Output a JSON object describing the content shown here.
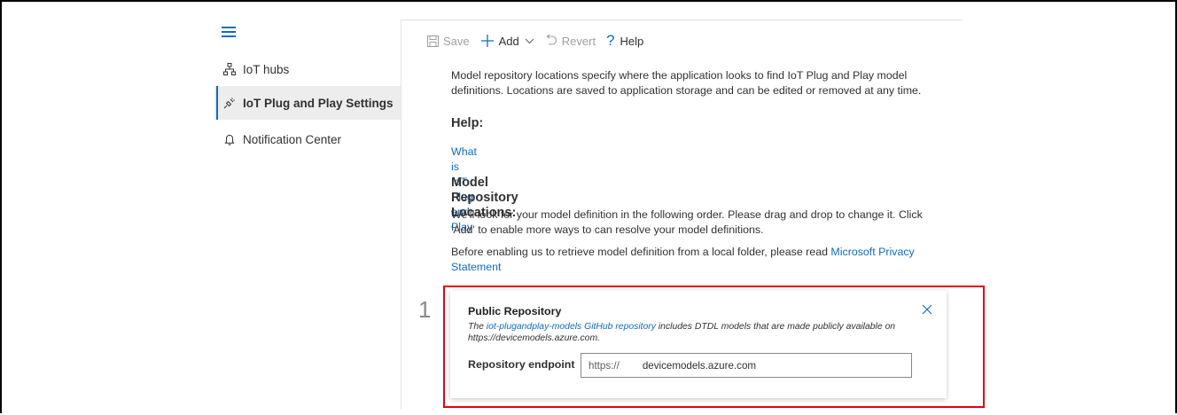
{
  "sidebar": {
    "items": [
      {
        "label": "IoT hubs",
        "icon": "hub-icon"
      },
      {
        "label": "IoT Plug and Play Settings",
        "icon": "plug-icon",
        "active": true
      },
      {
        "label": "Notification Center",
        "icon": "bell-icon"
      }
    ]
  },
  "toolbar": {
    "save_label": "Save",
    "add_label": "Add",
    "revert_label": "Revert",
    "help_label": "Help"
  },
  "main": {
    "intro": "Model repository locations specify where the application looks to find IoT Plug and Play model definitions. Locations are saved to application storage and can be edited or removed at any time.",
    "help_heading": "Help:",
    "help_link": "What is IoT Plug and Play",
    "locations_heading": "Model Repository Locations:",
    "order_text": "We'll look for your model definition in the following order. Please drag and drop to change it. Click 'Add' to enable more ways to can resolve your model definitions.",
    "privacy_prefix": "Before enabling us to retrieve model definition from a local folder, please read ",
    "privacy_link": "Microsoft Privacy Statement"
  },
  "repositories": [
    {
      "order": "1",
      "title": "Public Repository",
      "desc_prefix": "The ",
      "desc_link": "iot-plugandplay-models GitHub repository",
      "desc_suffix": " includes DTDL models that are made publicly available on https://devicemodels.azure.com.",
      "endpoint_label": "Repository endpoint",
      "endpoint_prefix": "https://",
      "endpoint_value": "devicemodels.azure.com"
    }
  ],
  "colors": {
    "accent": "#0f6cbd",
    "highlight": "#e5000f",
    "active_bg": "#ededed"
  }
}
